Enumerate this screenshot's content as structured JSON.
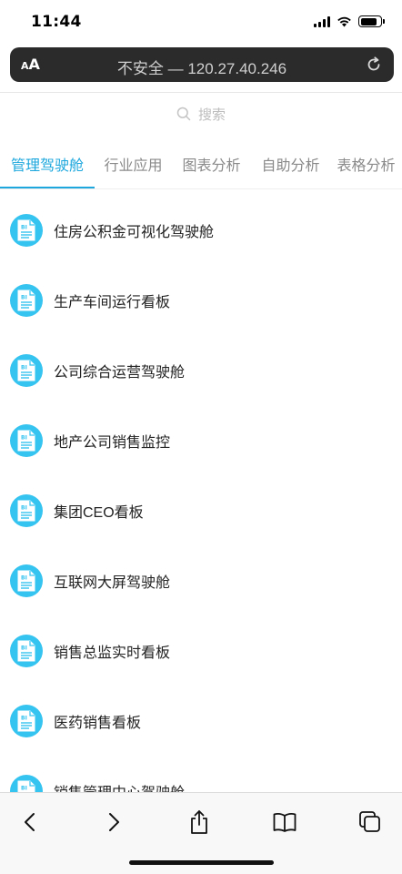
{
  "status_bar": {
    "time": "11:44",
    "signal_bars": 4,
    "battery_level": 0.85
  },
  "address_bar": {
    "text_size_label_small": "A",
    "text_size_label_large": "A",
    "url": "不安全 — 120.27.40.246",
    "reload_icon": "reload-icon"
  },
  "search": {
    "placeholder": "搜索",
    "icon": "search-icon"
  },
  "tabs": [
    {
      "label": "管理驾驶舱",
      "active": true
    },
    {
      "label": "行业应用",
      "active": false
    },
    {
      "label": "图表分析",
      "active": false
    },
    {
      "label": "自助分析",
      "active": false
    },
    {
      "label": "表格分析",
      "active": false
    }
  ],
  "items": [
    {
      "label": "住房公积金可视化驾驶舱",
      "icon": "bi-report-icon"
    },
    {
      "label": "生产车间运行看板",
      "icon": "bi-report-icon"
    },
    {
      "label": "公司综合运营驾驶舱",
      "icon": "bi-report-icon"
    },
    {
      "label": "地产公司销售监控",
      "icon": "bi-report-icon"
    },
    {
      "label": "集团CEO看板",
      "icon": "bi-report-icon"
    },
    {
      "label": "互联网大屏驾驶舱",
      "icon": "bi-report-icon"
    },
    {
      "label": "销售总监实时看板",
      "icon": "bi-report-icon"
    },
    {
      "label": "医药销售看板",
      "icon": "bi-report-icon"
    },
    {
      "label": "销售管理中心驾驶舱",
      "icon": "bi-report-icon"
    }
  ],
  "toolbar": {
    "buttons": [
      "back-icon",
      "forward-icon",
      "share-icon",
      "bookmarks-icon",
      "tabs-icon"
    ]
  },
  "colors": {
    "accent": "#1da7dd",
    "icon_bg": "#35c3f0",
    "address_bar_bg": "#2b2b2b"
  }
}
